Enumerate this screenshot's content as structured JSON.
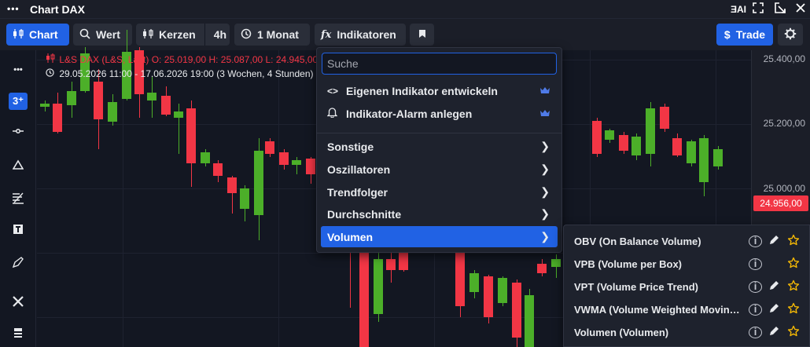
{
  "window": {
    "title": "Chart DAX",
    "menu_icon": "more-dots-icon",
    "ai_label": "ƎAI"
  },
  "toolbar": {
    "chart_label": "Chart",
    "value_label": "Wert",
    "candles_label": "Kerzen",
    "interval_label": "4h",
    "range_label": "1 Monat",
    "indicators_icon_label": "fx",
    "indicators_label": "Indikatoren",
    "trade_label": "Trade",
    "trade_icon": "$"
  },
  "legend": {
    "line1": "L&S DAX (L&S, Last)  O: 25.019,00  H: 25.087,00  L: 24.945,00",
    "line2": "29.05.2026 11:00 - 17.06.2026 19:00  (3 Wochen, 4 Stunden)"
  },
  "price_axis": {
    "labels": [
      "25.400,00",
      "25.200,00",
      "25.000,00"
    ],
    "current_price": "24.956,00"
  },
  "indicator_menu": {
    "search_placeholder": "Suche",
    "items": [
      {
        "label": "Eigenen Indikator entwickeln",
        "icon": "code-icon",
        "premium": true
      },
      {
        "label": "Indikator-Alarm anlegen",
        "icon": "bell-icon",
        "premium": true
      }
    ],
    "categories": [
      {
        "label": "Sonstige"
      },
      {
        "label": "Oszillatoren"
      },
      {
        "label": "Trendfolger"
      },
      {
        "label": "Durchschnitte"
      },
      {
        "label": "Volumen",
        "selected": true
      }
    ]
  },
  "volume_submenu": {
    "items": [
      {
        "label": "OBV (On Balance Volume)",
        "editable": true
      },
      {
        "label": "VPB (Volume per Box)",
        "editable": false
      },
      {
        "label": "VPT (Volume Price Trend)",
        "editable": true
      },
      {
        "label": "VWMA (Volume Weighted Moving Average)",
        "editable": true
      },
      {
        "label": "Volumen (Volumen)",
        "editable": true
      }
    ]
  },
  "colors": {
    "accent": "#2162e4",
    "up": "#4caf29",
    "down": "#f23645",
    "premium": "#4f7be8"
  }
}
